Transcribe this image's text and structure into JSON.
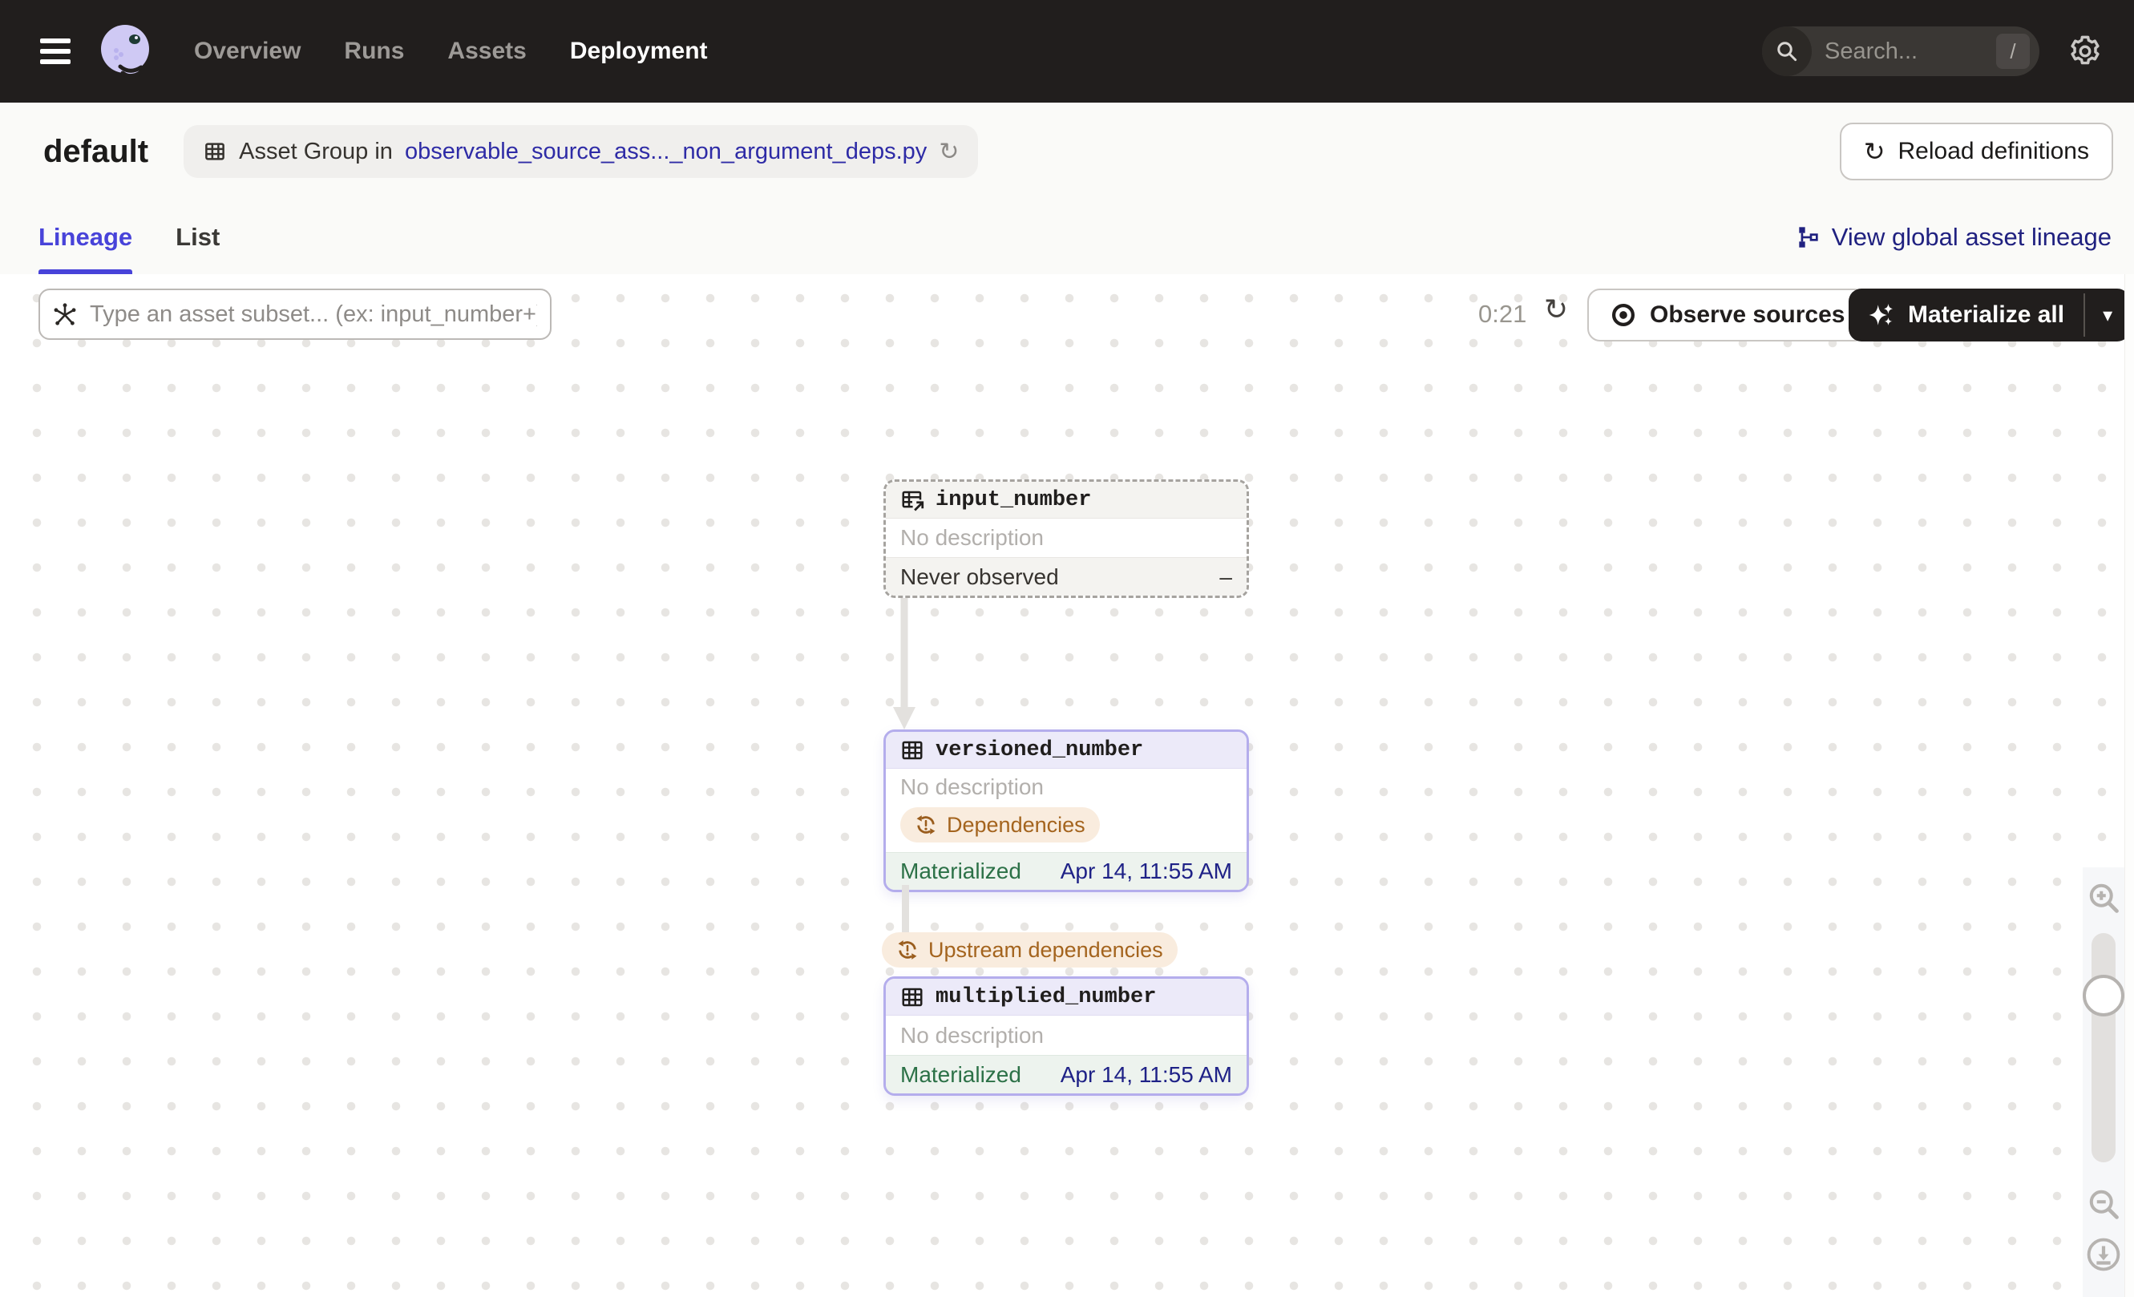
{
  "nav": {
    "items": [
      {
        "label": "Overview",
        "active": false
      },
      {
        "label": "Runs",
        "active": false
      },
      {
        "label": "Assets",
        "active": false
      },
      {
        "label": "Deployment",
        "active": true
      }
    ],
    "search": {
      "placeholder": "Search...",
      "shortcut": "/"
    }
  },
  "header": {
    "title": "default",
    "breadcrumb_prefix": "Asset Group in",
    "breadcrumb_link": "observable_source_ass..._non_argument_deps.py",
    "reload_button_label": "Reload definitions"
  },
  "tabs": [
    {
      "label": "Lineage",
      "active": true
    },
    {
      "label": "List",
      "active": false
    }
  ],
  "lineage_header": {
    "view_global_label": "View global asset lineage"
  },
  "toolbar": {
    "subset_placeholder": "Type an asset subset... (ex: input_number+)",
    "timer": "0:21",
    "observe_label": "Observe sources",
    "materialize_label": "Materialize all"
  },
  "graph": {
    "nodes": [
      {
        "name": "input_number",
        "description": "No description",
        "status": "Never observed",
        "status_value": "–",
        "kind": "observable-source"
      },
      {
        "name": "versioned_number",
        "description": "No description",
        "tag": "Dependencies",
        "status": "Materialized",
        "status_value": "Apr 14, 11:55 AM",
        "kind": "asset"
      },
      {
        "name": "multiplied_number",
        "description": "No description",
        "status": "Materialized",
        "status_value": "Apr 14, 11:55 AM",
        "kind": "asset"
      }
    ],
    "edge_tag": "Upstream dependencies"
  },
  "icons": {
    "hamburger": "menu-icon",
    "logo": "dagster-octopus-logo",
    "search": "magnifier",
    "shortcut_key": "slash-key",
    "settings": "gear-icon",
    "breadcrumb": "asset-table-icon",
    "refresh": "circular-arrow",
    "global_lineage": "graph-branch-icon",
    "subset": "op-selector-asterisk",
    "observe": "eye-icon",
    "materialize": "sparkles-icon",
    "dropdown": "caret-down",
    "dependency": "cycle-exclamation-icon",
    "zoom_in": "magnifier-plus",
    "zoom_out": "magnifier-minus",
    "download": "download-circle-icon"
  },
  "colors": {
    "nav_bg": "#211E1D",
    "accent_tab": "#4843D9",
    "link_blue": "#2E2BA6",
    "navy_link": "#202180",
    "node_border_purple": "#B4ADEC",
    "node_header_purple": "#ECEAF9",
    "materialized_green": "#2C7147",
    "footer_green_bg": "#EDF3EE",
    "timestamp_navy": "#1F2287",
    "warning_orange": "#A4641E",
    "warning_bg": "#F9ECDE",
    "edge_gray": "#E3E1DE"
  }
}
